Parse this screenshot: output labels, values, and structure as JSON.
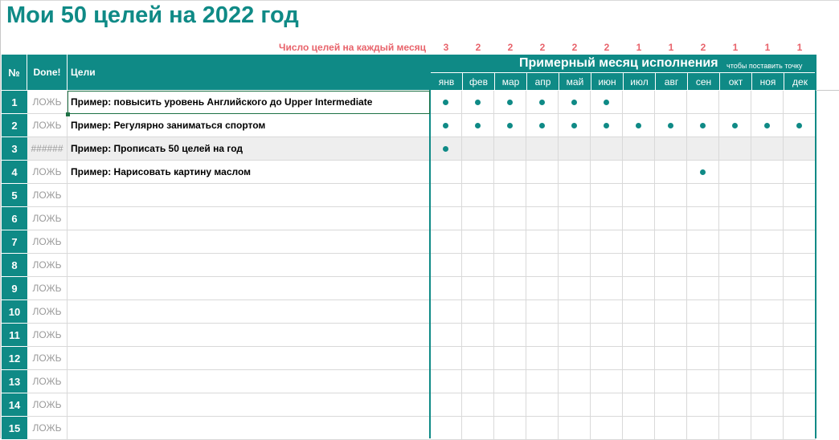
{
  "title": "Мои 50 целей на 2022 год",
  "counts_label": "Число целей на каждый месяц",
  "month_counts": [
    "3",
    "2",
    "2",
    "2",
    "2",
    "2",
    "1",
    "1",
    "2",
    "1",
    "1",
    "1"
  ],
  "headers": {
    "num": "№",
    "done": "Done!",
    "goals": "Цели",
    "months_title": "Примерный месяц исполнения",
    "months_hint": "чтобы поставить точку"
  },
  "months": [
    "янв",
    "фев",
    "мар",
    "апр",
    "май",
    "июн",
    "июл",
    "авг",
    "сен",
    "окт",
    "ноя",
    "дек"
  ],
  "colors": {
    "accent": "#0f8a86",
    "counts": "#e8636b",
    "shaded_row": "#eeeeee"
  },
  "rows": [
    {
      "num": "1",
      "done": "ЛОЖЬ",
      "goal": "Пример: повысить уровень Английского до Upper Intermediate",
      "months": [
        1,
        1,
        1,
        1,
        1,
        1,
        0,
        0,
        0,
        0,
        0,
        0
      ]
    },
    {
      "num": "2",
      "done": "ЛОЖЬ",
      "goal": "Пример: Регулярно заниматься спортом",
      "months": [
        1,
        1,
        1,
        1,
        1,
        1,
        1,
        1,
        1,
        1,
        1,
        1
      ]
    },
    {
      "num": "3",
      "done": "######",
      "goal": "Пример: Прописать 50 целей на год",
      "months": [
        1,
        0,
        0,
        0,
        0,
        0,
        0,
        0,
        0,
        0,
        0,
        0
      ],
      "shaded": true
    },
    {
      "num": "4",
      "done": "ЛОЖЬ",
      "goal": "Пример: Нарисовать картину маслом",
      "months": [
        0,
        0,
        0,
        0,
        0,
        0,
        0,
        0,
        1,
        0,
        0,
        0
      ]
    },
    {
      "num": "5",
      "done": "ЛОЖЬ",
      "goal": "",
      "months": [
        0,
        0,
        0,
        0,
        0,
        0,
        0,
        0,
        0,
        0,
        0,
        0
      ]
    },
    {
      "num": "6",
      "done": "ЛОЖЬ",
      "goal": "",
      "months": [
        0,
        0,
        0,
        0,
        0,
        0,
        0,
        0,
        0,
        0,
        0,
        0
      ]
    },
    {
      "num": "7",
      "done": "ЛОЖЬ",
      "goal": "",
      "months": [
        0,
        0,
        0,
        0,
        0,
        0,
        0,
        0,
        0,
        0,
        0,
        0
      ]
    },
    {
      "num": "8",
      "done": "ЛОЖЬ",
      "goal": "",
      "months": [
        0,
        0,
        0,
        0,
        0,
        0,
        0,
        0,
        0,
        0,
        0,
        0
      ]
    },
    {
      "num": "9",
      "done": "ЛОЖЬ",
      "goal": "",
      "months": [
        0,
        0,
        0,
        0,
        0,
        0,
        0,
        0,
        0,
        0,
        0,
        0
      ]
    },
    {
      "num": "10",
      "done": "ЛОЖЬ",
      "goal": "",
      "months": [
        0,
        0,
        0,
        0,
        0,
        0,
        0,
        0,
        0,
        0,
        0,
        0
      ]
    },
    {
      "num": "11",
      "done": "ЛОЖЬ",
      "goal": "",
      "months": [
        0,
        0,
        0,
        0,
        0,
        0,
        0,
        0,
        0,
        0,
        0,
        0
      ]
    },
    {
      "num": "12",
      "done": "ЛОЖЬ",
      "goal": "",
      "months": [
        0,
        0,
        0,
        0,
        0,
        0,
        0,
        0,
        0,
        0,
        0,
        0
      ]
    },
    {
      "num": "13",
      "done": "ЛОЖЬ",
      "goal": "",
      "months": [
        0,
        0,
        0,
        0,
        0,
        0,
        0,
        0,
        0,
        0,
        0,
        0
      ]
    },
    {
      "num": "14",
      "done": "ЛОЖЬ",
      "goal": "",
      "months": [
        0,
        0,
        0,
        0,
        0,
        0,
        0,
        0,
        0,
        0,
        0,
        0
      ]
    },
    {
      "num": "15",
      "done": "ЛОЖЬ",
      "goal": "",
      "months": [
        0,
        0,
        0,
        0,
        0,
        0,
        0,
        0,
        0,
        0,
        0,
        0
      ]
    }
  ]
}
